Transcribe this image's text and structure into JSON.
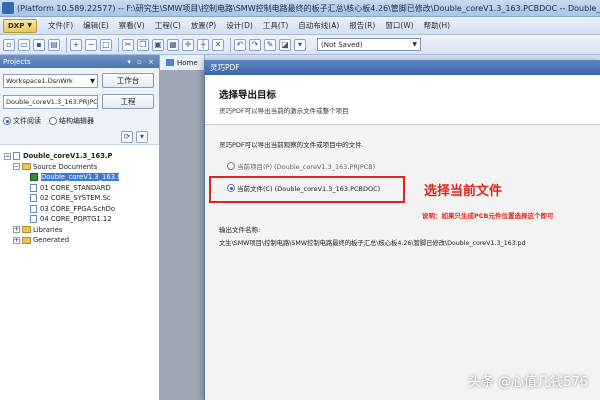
{
  "window": {
    "title": "(Platform 10.589.22577) -- F:\\研究生\\SMW项目\\控制电路\\SMW控制电路最终的板子汇总\\核心板4.26\\管脚已修改\\Double_coreV1.3_163.PCBDOC -- Double_"
  },
  "menubar": {
    "dxp": "DXP",
    "items": [
      "文件(F)",
      "编辑(E)",
      "察看(V)",
      "工程(C)",
      "放置(P)",
      "设计(D)",
      "工具(T)",
      "自动布线(A)",
      "报告(R)",
      "窗口(W)",
      "帮助(H)"
    ]
  },
  "toolbar": {
    "save_state": "(Not Saved)"
  },
  "projects_panel": {
    "title": "Projects",
    "workspace_value": "Workspace1.DsnWrk",
    "workspace_button": "工作台",
    "project_value": "Double_coreV1.3_163.PRJPCB",
    "project_button": "工程",
    "view_options": [
      "文件阅读",
      "结构编辑器"
    ],
    "tree": {
      "root": "Double_coreV1.3_163.P",
      "source_documents": "Source Documents",
      "files": [
        "Double_coreV1.3_163.I",
        "01 CORE_STANDARD",
        "02 CORE_SYSTEM.Sc",
        "03 CORE_FPGA.SchDo",
        "04 CORE_PORTG1.12"
      ],
      "libraries": "Libraries",
      "generated": "Generated"
    }
  },
  "tabs": [
    {
      "label": "Home"
    }
  ],
  "dialog": {
    "title": "灵巧PDF",
    "heading": "选择导出目标",
    "subheading": "灵巧PDF可以导出当前的激示文件或整个项目",
    "description": "灵巧PDF可以导出当前观察的文件或项目中的文件.",
    "option_project": "当前项目(P) (Double_coreV1.3_163.PRJPCB)",
    "option_current_file": "当前文件(C) (Double_coreV1.3_163.PCBDOC)",
    "annotation_title": "选择当前文件",
    "annotation_note": "说明：如果只生成PCB元件位置选择这个即可",
    "output_label": "输出文件名称:",
    "output_path": "文生\\SMW项目\\控制电路\\SMW控制电路最终的板子汇总\\核心板4.26\\管脚已修改\\Double_coreV1.3_163.pd"
  },
  "watermark": "头条 @心值几钱576",
  "colors": {
    "annotation_red": "#e0241c",
    "selection_blue": "#3a79d0"
  }
}
